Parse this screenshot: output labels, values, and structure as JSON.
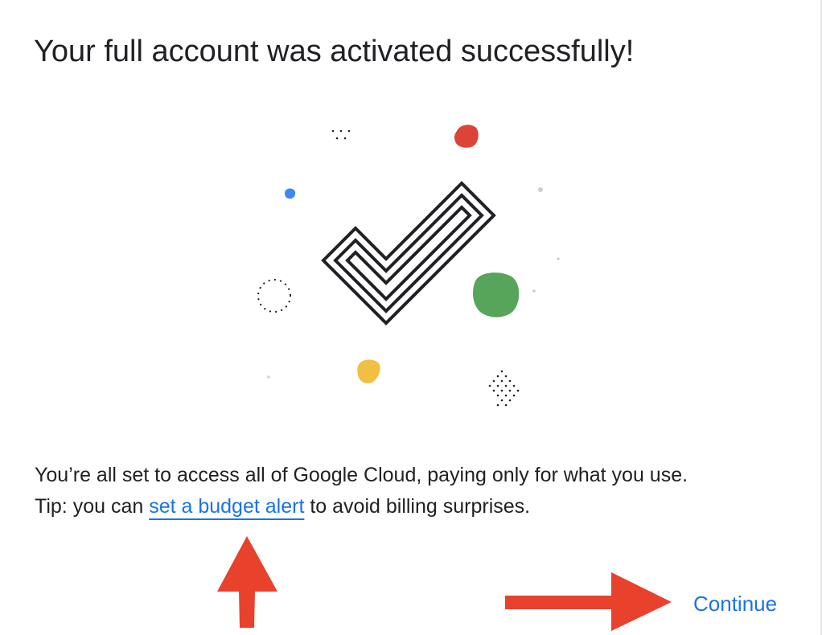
{
  "dialog": {
    "title": "Your full account was activated successfully!",
    "message_line1": "You’re all set to access all of Google Cloud, paying only for what you use.",
    "tip_prefix": "Tip: you can ",
    "tip_link": "set a budget alert",
    "tip_suffix": " to avoid billing surprises.",
    "continue_label": "Continue"
  },
  "colors": {
    "link_blue": "#1a73e8",
    "annotation_arrow": "#e8412c",
    "blob_red": "#db4437",
    "blob_blue": "#4285f4",
    "blob_green": "#57a55a",
    "blob_yellow": "#f1bf42"
  },
  "icons": [
    "success-checkmark-icon",
    "annotation-arrow-up-icon",
    "annotation-arrow-right-icon"
  ]
}
